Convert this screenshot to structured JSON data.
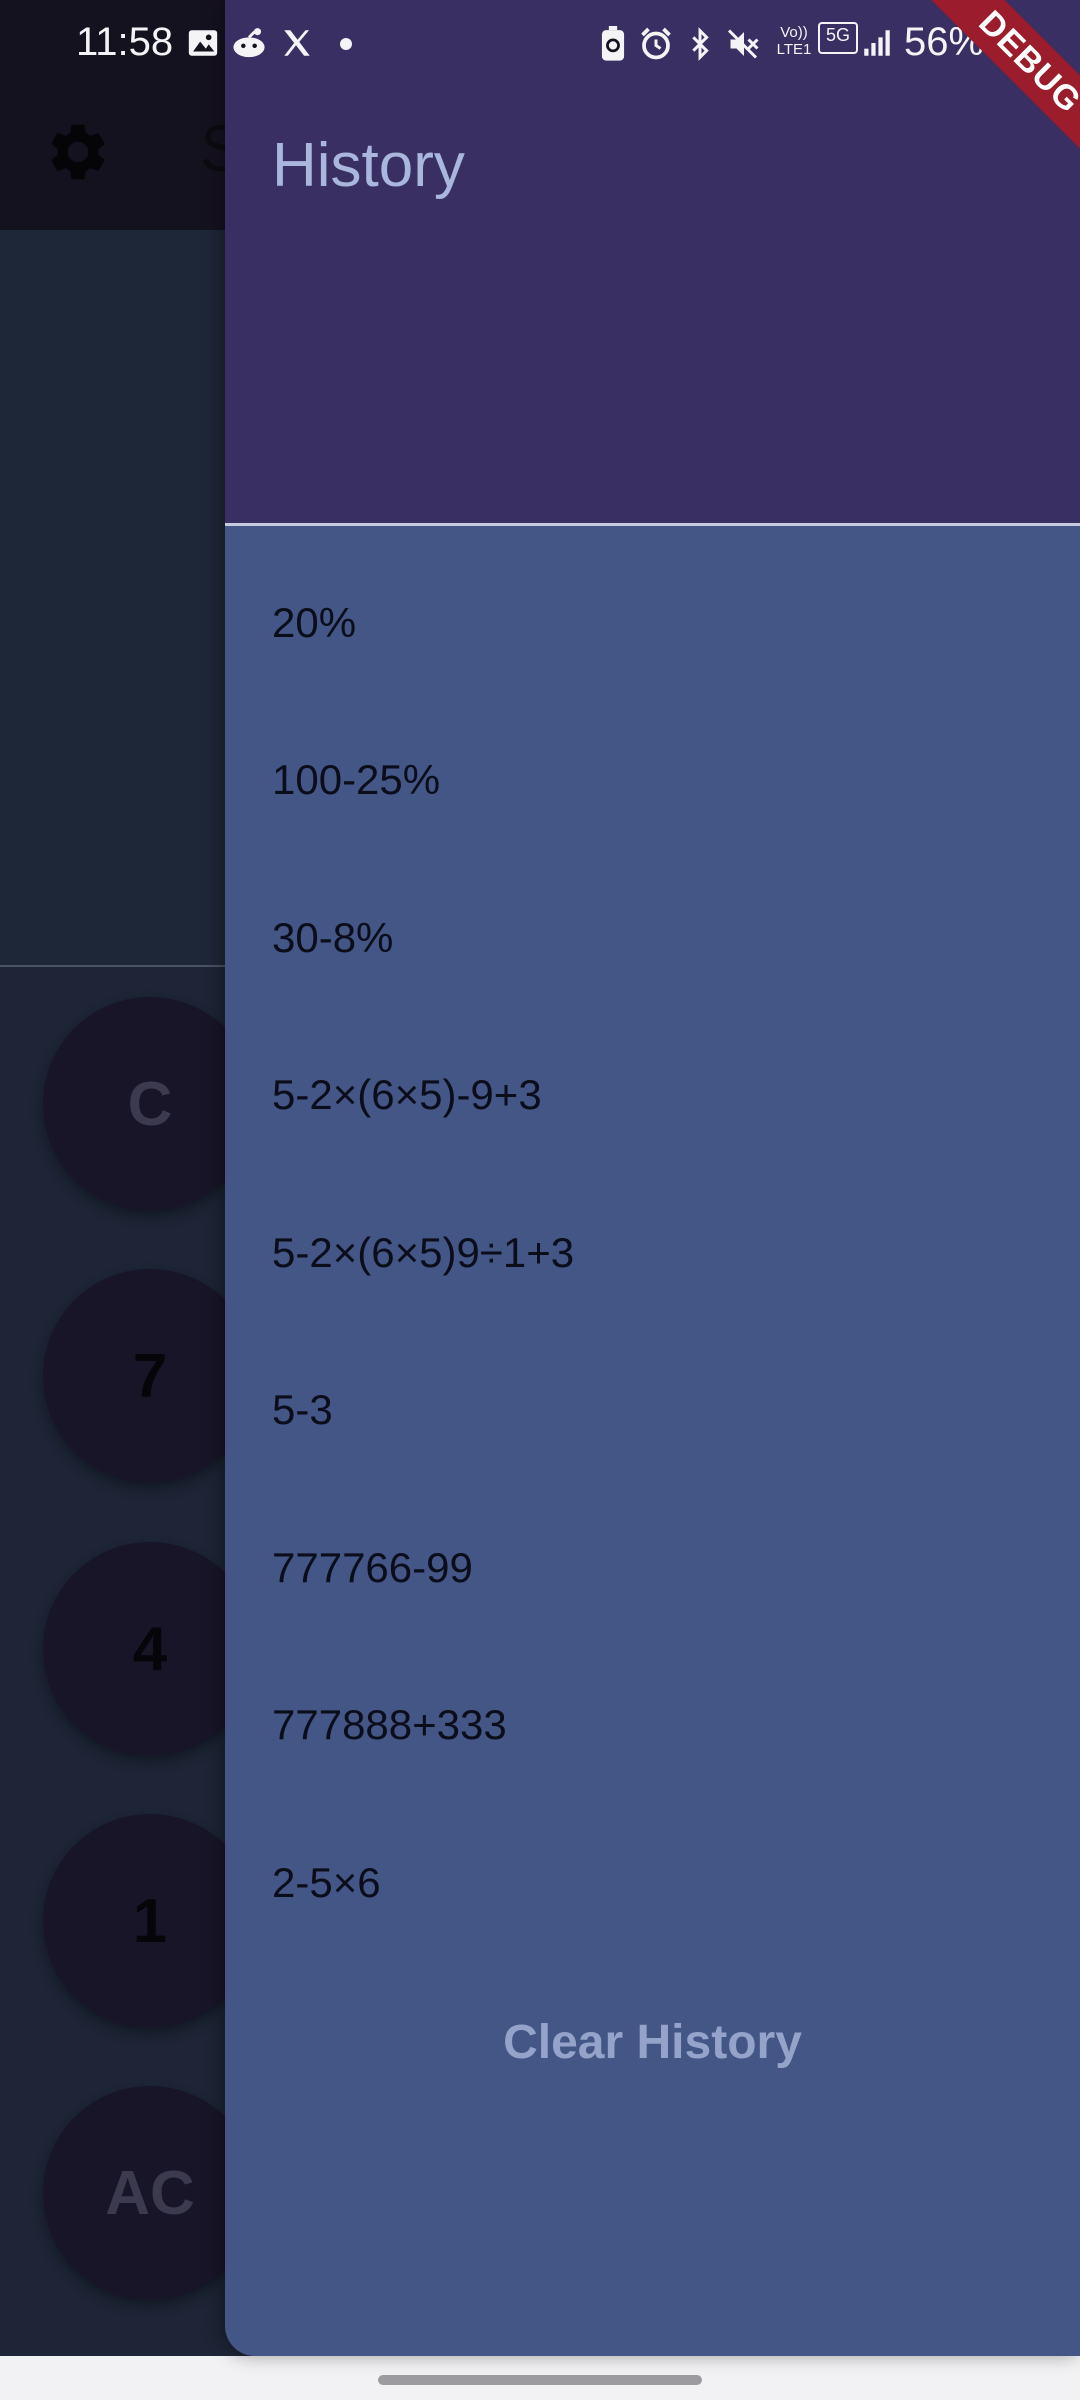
{
  "status_bar": {
    "time": "11:58",
    "network_label": "Vo)) LTE1",
    "network_type": "5G",
    "battery": "56%",
    "left_icons": [
      "gallery-icon",
      "reddit-icon",
      "x-icon",
      "notification-dot-icon"
    ],
    "right_icons": [
      "battery-saver-icon",
      "alarm-icon",
      "bluetooth-icon",
      "mute-icon",
      "volte-icon",
      "5g-icon",
      "signal-icon"
    ]
  },
  "debug_banner": "DEBUG",
  "app": {
    "title": "S",
    "keypad": [
      {
        "label": "C",
        "style": "dim"
      },
      {
        "label": "7",
        "style": "dark"
      },
      {
        "label": "4",
        "style": "dark"
      },
      {
        "label": "1",
        "style": "dark"
      },
      {
        "label": "AC",
        "style": "dim"
      }
    ]
  },
  "drawer": {
    "title": "History",
    "items": [
      "20%",
      "100-25%",
      "30-8%",
      "5-2×(6×5)-9+3",
      "5-2×(6×5)9÷1+3",
      "5-3",
      "777766-99",
      "777888+333",
      "2-5×6"
    ],
    "clear_label": "Clear History"
  },
  "colors": {
    "drawer_header": "#392f62",
    "drawer_body": "#445686",
    "app_bar": "#15121f",
    "app_background": "#1e2738",
    "key_background": "#181528",
    "debug_ribbon": "#9b1c2b"
  }
}
